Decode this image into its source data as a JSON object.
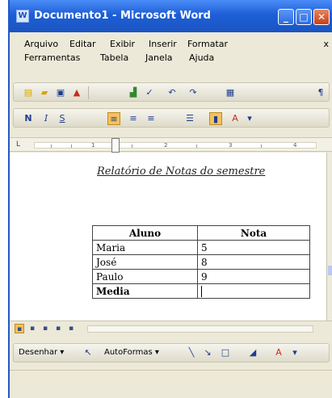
{
  "window": {
    "title": "Documento1 - Microsoft Word",
    "app_icon": "word-icon"
  },
  "menu": {
    "row1": [
      "Arquivo",
      "Editar",
      "Exibir",
      "Inserir",
      "Formatar"
    ],
    "row2": [
      "Ferramentas",
      "Tabela",
      "Janela",
      "Ajuda"
    ],
    "close_glyph": "x"
  },
  "toolbar_standard": {
    "icons": [
      "new-document-icon",
      "open-folder-icon",
      "save-icon",
      "permission-icon",
      "print-icon",
      "spelling-icon",
      "undo-icon",
      "redo-icon",
      "table-icon",
      "paragraph-mark-icon"
    ]
  },
  "toolbar_format": {
    "bold": "N",
    "italic": "I",
    "underline": "S"
  },
  "ruler": {
    "numbers": [
      "1",
      "2",
      "3",
      "4"
    ]
  },
  "document": {
    "heading": "Relatório de Notas do semestre",
    "table": {
      "headers": [
        "Aluno",
        "Nota"
      ],
      "rows": [
        [
          "Maria",
          "5"
        ],
        [
          "José",
          "8"
        ],
        [
          "Paulo",
          "9"
        ],
        [
          "Media",
          ""
        ]
      ]
    }
  },
  "drawing_toolbar": {
    "draw_label": "Desenhar ▾",
    "autoshapes_label": "AutoFormas ▾"
  },
  "colors": {
    "titlebar": "#1d5fd6",
    "active_button": "#f4c15d",
    "font_color_underline": "#c62d1e",
    "highlight": "#f4e04d"
  }
}
